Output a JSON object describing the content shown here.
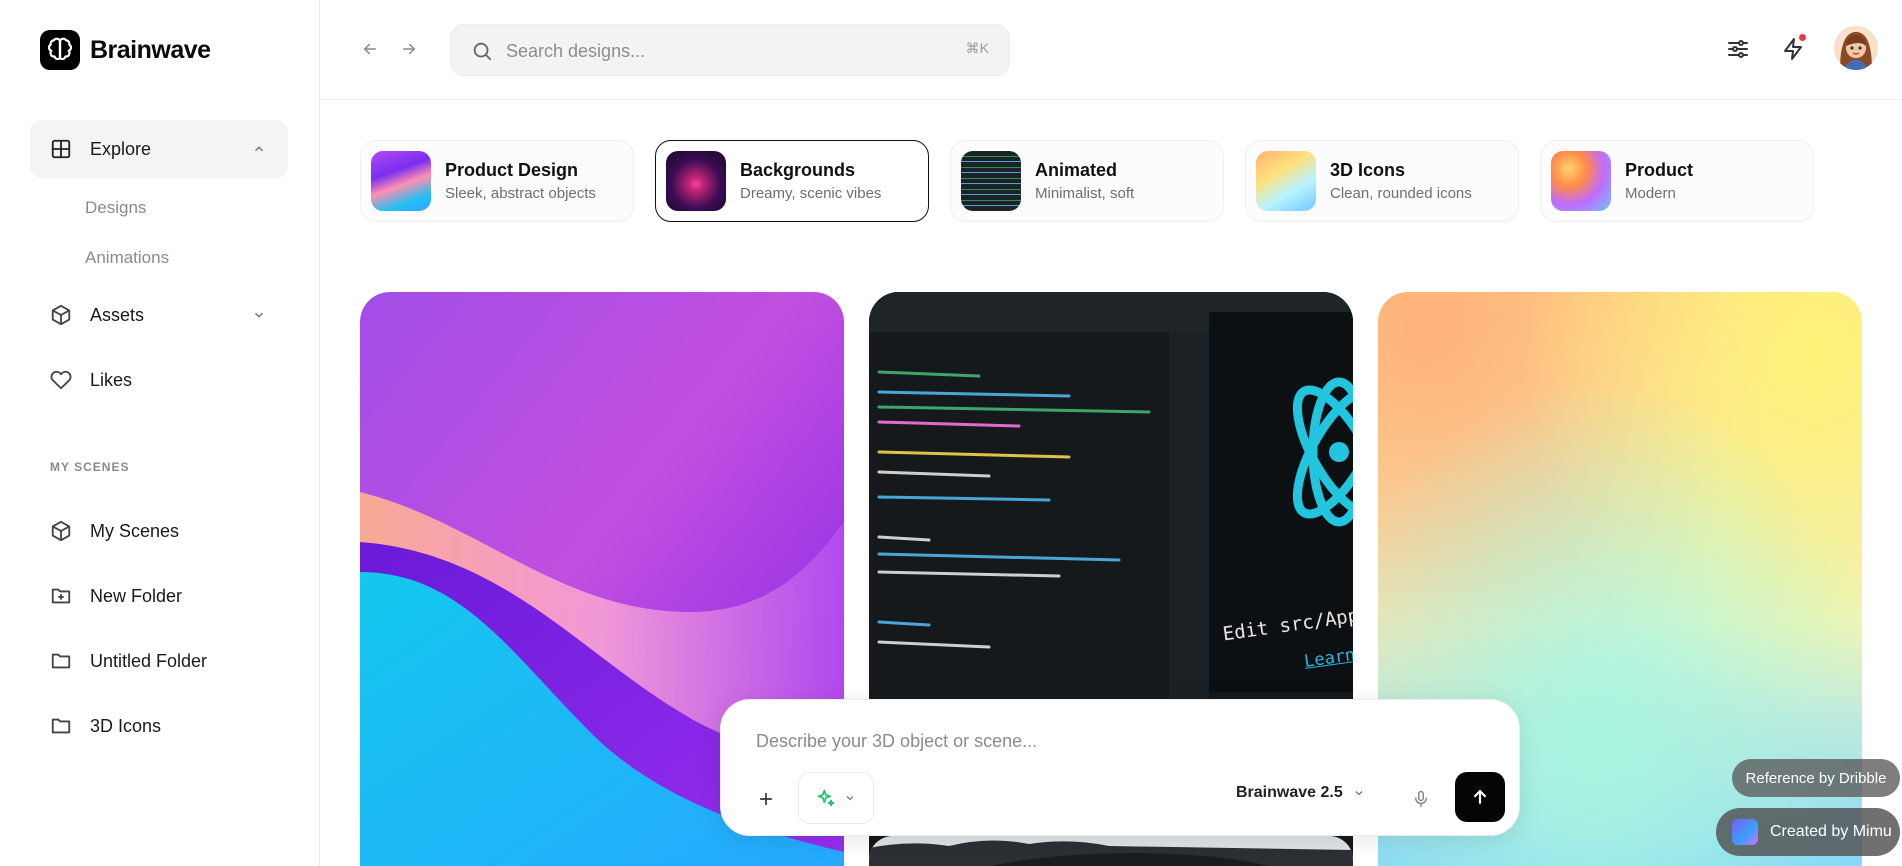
{
  "brand": {
    "name": "Brainwave"
  },
  "sidebar": {
    "explore": {
      "label": "Explore",
      "sub_items": [
        "Designs",
        "Animations"
      ]
    },
    "assets": {
      "label": "Assets"
    },
    "likes": {
      "label": "Likes"
    },
    "section_title": "MY SCENES",
    "scenes": [
      "My Scenes",
      "New Folder",
      "Untitled Folder",
      "3D Icons"
    ]
  },
  "header": {
    "search_placeholder": "Search designs...",
    "search_shortcut": "⌘K"
  },
  "categories": [
    {
      "title": "Product Design",
      "subtitle": "Sleek, abstract objects"
    },
    {
      "title": "Backgrounds",
      "subtitle": "Dreamy, scenic vibes"
    },
    {
      "title": "Animated",
      "subtitle": "Minimalist, soft"
    },
    {
      "title": "3D Icons",
      "subtitle": "Clean, rounded icons"
    },
    {
      "title": "Product",
      "subtitle": "Modern"
    }
  ],
  "gallery": {
    "code_tile_text": "Edit src/App.js a",
    "code_tile_link": "Learn R"
  },
  "prompt": {
    "placeholder": "Describe your 3D object or scene...",
    "model": "Brainwave 2.5"
  },
  "badges": {
    "reference": "Reference by Dribble",
    "created": "Created by Mimu"
  },
  "colors": {
    "accent": "#000000",
    "notification": "#ef3340",
    "selected_border": "#111111"
  }
}
